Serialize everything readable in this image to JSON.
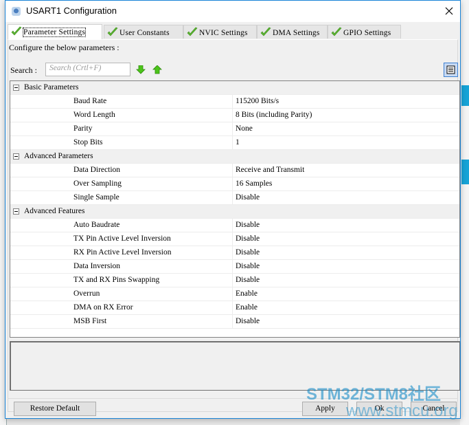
{
  "window": {
    "title": "USART1 Configuration",
    "close_glyph": "✕"
  },
  "tabs": [
    {
      "label": "Parameter Settings",
      "active": true,
      "icon": "check-icon"
    },
    {
      "label": "User Constants",
      "active": false,
      "icon": "check-icon"
    },
    {
      "label": "NVIC Settings",
      "active": false,
      "icon": "check-icon"
    },
    {
      "label": "DMA Settings",
      "active": false,
      "icon": "check-icon"
    },
    {
      "label": "GPIO Settings",
      "active": false,
      "icon": "check-icon"
    }
  ],
  "panel": {
    "instruction": "Configure the below parameters :",
    "search_label": "Search :",
    "search_placeholder": "Search (Crtl+F)",
    "next_icon": "arrow-down-icon",
    "prev_icon": "arrow-up-icon",
    "view_icon": "list-view-icon"
  },
  "groups": [
    {
      "name": "Basic Parameters",
      "params": [
        {
          "name": "Baud Rate",
          "value": "115200 Bits/s"
        },
        {
          "name": "Word Length",
          "value": "8 Bits (including Parity)"
        },
        {
          "name": "Parity",
          "value": "None"
        },
        {
          "name": "Stop Bits",
          "value": "1"
        }
      ]
    },
    {
      "name": "Advanced Parameters",
      "params": [
        {
          "name": "Data Direction",
          "value": "Receive and Transmit"
        },
        {
          "name": "Over Sampling",
          "value": "16 Samples"
        },
        {
          "name": "Single Sample",
          "value": "Disable"
        }
      ]
    },
    {
      "name": "Advanced Features",
      "params": [
        {
          "name": "Auto Baudrate",
          "value": "Disable"
        },
        {
          "name": "TX Pin Active Level Inversion",
          "value": "Disable"
        },
        {
          "name": "RX Pin Active Level Inversion",
          "value": "Disable"
        },
        {
          "name": "Data Inversion",
          "value": "Disable"
        },
        {
          "name": "TX and RX Pins Swapping",
          "value": "Disable"
        },
        {
          "name": "Overrun",
          "value": "Enable"
        },
        {
          "name": "DMA on RX Error",
          "value": "Enable"
        },
        {
          "name": "MSB First",
          "value": "Disable"
        }
      ]
    }
  ],
  "buttons": {
    "restore_default": "Restore Default",
    "apply": "Apply",
    "ok": "Ok",
    "cancel": "Cancel"
  },
  "watermark": {
    "line1": "STM32/STM8社区",
    "line2": "www.stmcu.org"
  },
  "colors": {
    "accent_border": "#1883d7",
    "check_green": "#5cb531",
    "arrow_green": "#4cc41a"
  }
}
